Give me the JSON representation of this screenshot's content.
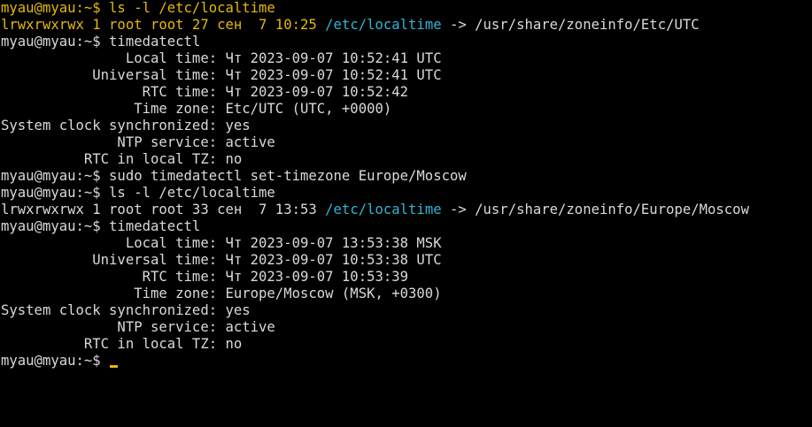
{
  "terminal": {
    "colors": {
      "background": "#000000",
      "default": "#d9d9d9",
      "yellow": "#e5b80b",
      "cyan": "#2fb5d4"
    },
    "lines": [
      [
        {
          "t": "myau@myau:~$ ls -l /etc/localtime",
          "c": "yellow"
        }
      ],
      [
        {
          "t": "lrwxrwxrwx 1 root root 27 сен  7 10:25 ",
          "c": "yellow"
        },
        {
          "t": "/etc/localtime",
          "c": "cyan"
        },
        {
          "t": " -> /usr/share/zoneinfo/Etc/UTC",
          "c": "white"
        }
      ],
      [
        {
          "t": "myau@myau:~$ timedatectl",
          "c": "white"
        }
      ],
      [
        {
          "t": "               Local time: Чт 2023-09-07 10:52:41 UTC",
          "c": "white"
        }
      ],
      [
        {
          "t": "           Universal time: Чт 2023-09-07 10:52:41 UTC",
          "c": "white"
        }
      ],
      [
        {
          "t": "                 RTC time: Чт 2023-09-07 10:52:42",
          "c": "white"
        }
      ],
      [
        {
          "t": "                Time zone: Etc/UTC (UTC, +0000)",
          "c": "white"
        }
      ],
      [
        {
          "t": "System clock synchronized: yes",
          "c": "white"
        }
      ],
      [
        {
          "t": "              NTP service: active",
          "c": "white"
        }
      ],
      [
        {
          "t": "          RTC in local TZ: no",
          "c": "white"
        }
      ],
      [
        {
          "t": "myau@myau:~$ sudo timedatectl set-timezone Europe/Moscow",
          "c": "white"
        }
      ],
      [
        {
          "t": "myau@myau:~$ ls -l /etc/localtime",
          "c": "white"
        }
      ],
      [
        {
          "t": "lrwxrwxrwx 1 root root 33 сен  7 13:53 ",
          "c": "white"
        },
        {
          "t": "/etc/localtime",
          "c": "cyan"
        },
        {
          "t": " -> /usr/share/zoneinfo/Europe/Moscow",
          "c": "white"
        }
      ],
      [
        {
          "t": "myau@myau:~$ timedatectl",
          "c": "white"
        }
      ],
      [
        {
          "t": "               Local time: Чт 2023-09-07 13:53:38 MSK",
          "c": "white"
        }
      ],
      [
        {
          "t": "           Universal time: Чт 2023-09-07 10:53:38 UTC",
          "c": "white"
        }
      ],
      [
        {
          "t": "                 RTC time: Чт 2023-09-07 10:53:39",
          "c": "white"
        }
      ],
      [
        {
          "t": "                Time zone: Europe/Moscow (MSK, +0300)",
          "c": "white"
        }
      ],
      [
        {
          "t": "System clock synchronized: yes",
          "c": "white"
        }
      ],
      [
        {
          "t": "              NTP service: active",
          "c": "white"
        }
      ],
      [
        {
          "t": "          RTC in local TZ: no",
          "c": "white"
        }
      ],
      [
        {
          "t": "myau@myau:~$ ",
          "c": "white"
        }
      ]
    ]
  }
}
